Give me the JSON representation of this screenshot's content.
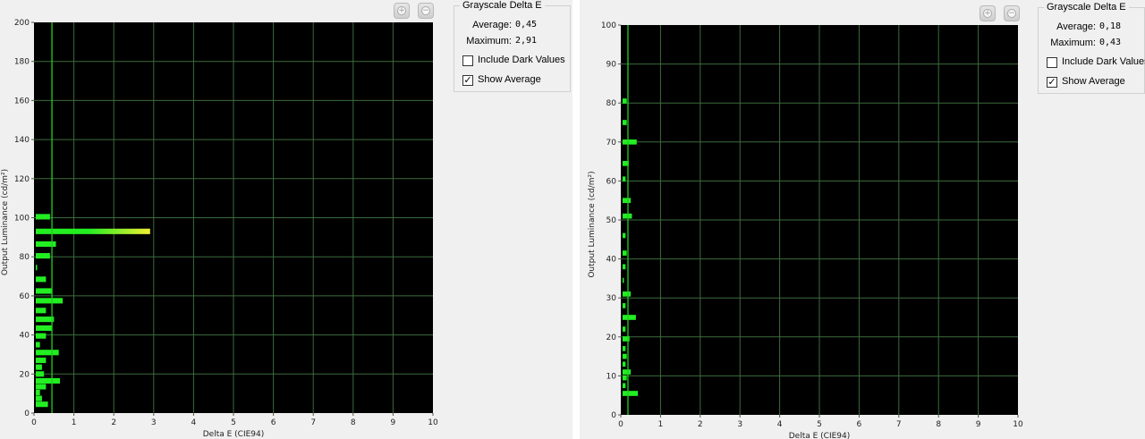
{
  "colors": {
    "plot_background": "#000000",
    "grid": "#3c6b3c",
    "bar_green": "#22ee22",
    "bar_yellow": "#ffee33",
    "average_line": "#22cc22"
  },
  "panels": [
    {
      "zoom_in_icon": "zoom-in-icon",
      "zoom_out_icon": "zoom-out-icon",
      "stats": {
        "title": "Grayscale Delta E",
        "average_label": "Average:",
        "average_value": "0,45",
        "maximum_label": "Maximum:",
        "maximum_value": "2,91",
        "include_dark_label": "Include Dark Values",
        "include_dark_checked": false,
        "show_average_label": "Show Average",
        "show_average_checked": true
      }
    },
    {
      "zoom_in_icon": "zoom-in-icon",
      "zoom_out_icon": "zoom-out-icon",
      "stats": {
        "title": "Grayscale Delta E",
        "average_label": "Average:",
        "average_value": "0,18",
        "maximum_label": "Maximum:",
        "maximum_value": "0,43",
        "include_dark_label": "Include Dark Values",
        "include_dark_checked": false,
        "show_average_label": "Show Average",
        "show_average_checked": true
      }
    }
  ],
  "chart_data": [
    {
      "type": "bar",
      "orientation": "horizontal",
      "xlabel": "Delta E (CIE94)",
      "ylabel": "Output Luminance (cd/m²)",
      "xlim": [
        0,
        10
      ],
      "ylim": [
        0,
        200
      ],
      "xticks": [
        "0",
        "1",
        "2",
        "3",
        "4",
        "5",
        "6",
        "7",
        "8",
        "9",
        "10"
      ],
      "yticks": [
        "0",
        "20",
        "40",
        "60",
        "80",
        "100",
        "120",
        "140",
        "160",
        "180",
        "200"
      ],
      "grid": true,
      "average": 0.45,
      "bar_thickness": 2.8,
      "bars": [
        {
          "y": 4.5,
          "x": 0.35
        },
        {
          "y": 7.5,
          "x": 0.2
        },
        {
          "y": 10.5,
          "x": 0.15
        },
        {
          "y": 13.5,
          "x": 0.3
        },
        {
          "y": 16.5,
          "x": 0.65
        },
        {
          "y": 20,
          "x": 0.25
        },
        {
          "y": 23.5,
          "x": 0.2
        },
        {
          "y": 27,
          "x": 0.3
        },
        {
          "y": 31,
          "x": 0.62
        },
        {
          "y": 35,
          "x": 0.15
        },
        {
          "y": 39.5,
          "x": 0.3
        },
        {
          "y": 43.5,
          "x": 0.45
        },
        {
          "y": 48,
          "x": 0.5
        },
        {
          "y": 52.5,
          "x": 0.3
        },
        {
          "y": 57.5,
          "x": 0.72
        },
        {
          "y": 62.5,
          "x": 0.45
        },
        {
          "y": 68.5,
          "x": 0.3
        },
        {
          "y": 74.5,
          "x": 0.07
        },
        {
          "y": 80.5,
          "x": 0.4
        },
        {
          "y": 86.5,
          "x": 0.55
        },
        {
          "y": 93,
          "x": 2.91
        },
        {
          "y": 100.5,
          "x": 0.4
        }
      ]
    },
    {
      "type": "bar",
      "orientation": "horizontal",
      "xlabel": "Delta E (CIE94)",
      "ylabel": "Output Luminance (cd/m²)",
      "xlim": [
        0,
        10
      ],
      "ylim": [
        0,
        100
      ],
      "xticks": [
        "0",
        "1",
        "2",
        "3",
        "4",
        "5",
        "6",
        "7",
        "8",
        "9",
        "10"
      ],
      "yticks": [
        "0",
        "10",
        "20",
        "30",
        "40",
        "50",
        "60",
        "70",
        "80",
        "90",
        "100"
      ],
      "grid": true,
      "average": 0.18,
      "bar_thickness": 1.3,
      "bars": [
        {
          "y": 5.5,
          "x": 0.43
        },
        {
          "y": 7.5,
          "x": 0.12
        },
        {
          "y": 9.5,
          "x": 0.15
        },
        {
          "y": 11,
          "x": 0.25
        },
        {
          "y": 13,
          "x": 0.12
        },
        {
          "y": 15,
          "x": 0.15
        },
        {
          "y": 17,
          "x": 0.12
        },
        {
          "y": 19.5,
          "x": 0.22
        },
        {
          "y": 22,
          "x": 0.12
        },
        {
          "y": 25,
          "x": 0.38
        },
        {
          "y": 28,
          "x": 0.12
        },
        {
          "y": 31,
          "x": 0.25
        },
        {
          "y": 34.5,
          "x": 0.05
        },
        {
          "y": 38,
          "x": 0.12
        },
        {
          "y": 41.5,
          "x": 0.15
        },
        {
          "y": 46,
          "x": 0.12
        },
        {
          "y": 51,
          "x": 0.28
        },
        {
          "y": 55,
          "x": 0.25
        },
        {
          "y": 60.5,
          "x": 0.12
        },
        {
          "y": 64.5,
          "x": 0.2
        },
        {
          "y": 70,
          "x": 0.4
        },
        {
          "y": 75,
          "x": 0.15
        },
        {
          "y": 80.5,
          "x": 0.15
        }
      ]
    }
  ]
}
